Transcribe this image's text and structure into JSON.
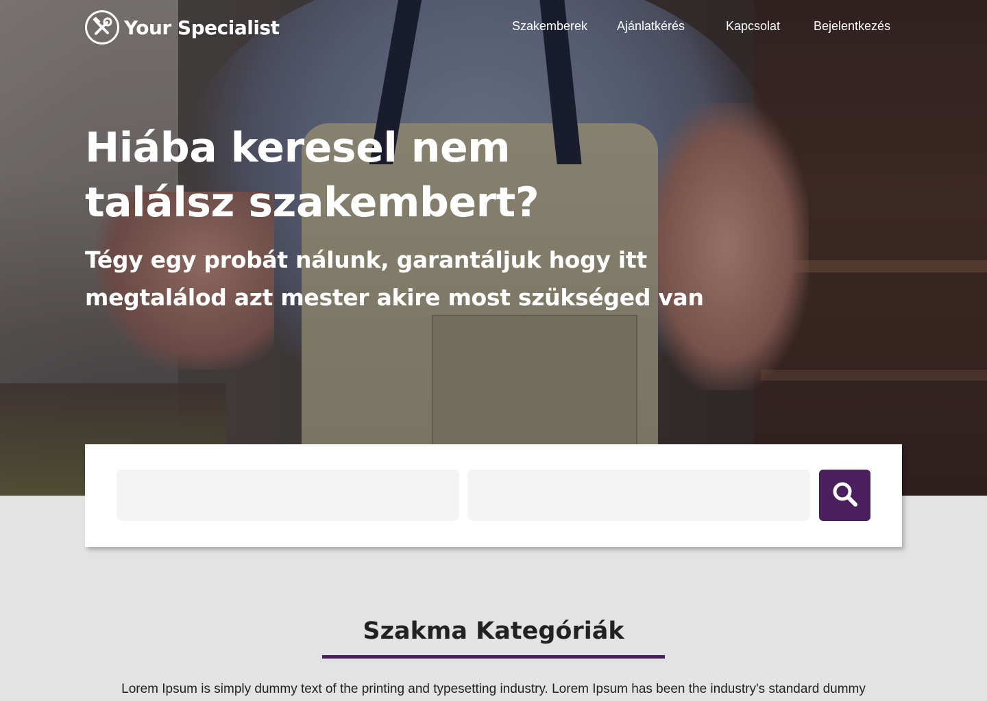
{
  "brand": {
    "name": "Your Specialist",
    "icon": "tools-icon"
  },
  "nav": {
    "items": [
      {
        "label": "Szakemberek"
      },
      {
        "label": "Ajánlatkérés"
      },
      {
        "label": "Kapcsolat"
      },
      {
        "label": "Bejelentkezés"
      }
    ]
  },
  "hero": {
    "title_line1": "Hiába keresel nem",
    "title_line2": "találsz szakembert?",
    "subtitle_line1": "Tégy egy probát nálunk, garantáljuk hogy itt",
    "subtitle_line2": "megtalálod azt mester akire most szükséged van"
  },
  "search": {
    "field1_value": "",
    "field2_value": "",
    "button_icon": "search-icon"
  },
  "categories": {
    "title": "Szakma Kategóriák",
    "description": "Lorem Ipsum is simply dummy text of the printing and typesetting industry. Lorem Ipsum has been the industry's standard dummy"
  },
  "colors": {
    "accent": "#4b1f5e",
    "background": "#e3e3e4",
    "card": "#ffffff",
    "input": "#f4f4f4"
  }
}
